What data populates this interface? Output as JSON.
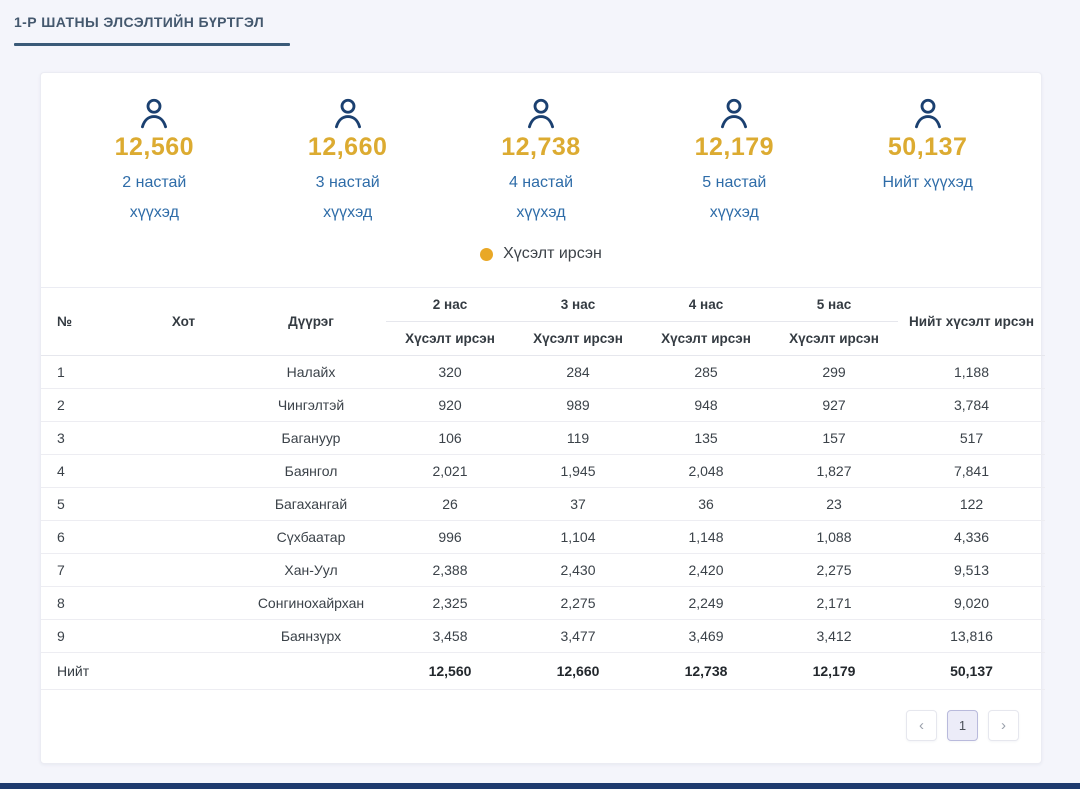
{
  "tab": {
    "title": "1-Р ШАТНЫ ЭЛСЭЛТИЙН БҮРТГЭЛ"
  },
  "stats": {
    "cards": [
      {
        "value": "12,560",
        "label1": "2 настай",
        "label2": "хүүхэд"
      },
      {
        "value": "12,660",
        "label1": "3 настай",
        "label2": "хүүхэд"
      },
      {
        "value": "12,738",
        "label1": "4 настай",
        "label2": "хүүхэд"
      },
      {
        "value": "12,179",
        "label1": "5 настай",
        "label2": "хүүхэд"
      },
      {
        "value": "50,137",
        "label1": "Нийт хүүхэд",
        "label2": ""
      }
    ],
    "legend": {
      "label": "Хүсэлт ирсэн",
      "dot_color": "#e9a826"
    }
  },
  "table": {
    "headers": {
      "no": "№",
      "city": "Хот",
      "district": "Дүүрэг",
      "age_groups": [
        "2 нас",
        "3 нас",
        "4 нас",
        "5 нас"
      ],
      "sub": "Хүсэлт ирсэн",
      "grand_total": "Нийт хүсэлт ирсэн"
    },
    "rows": [
      {
        "no": "1",
        "city": "",
        "district": "Налайх",
        "age2": "320",
        "age3": "284",
        "age4": "285",
        "age5": "299",
        "total": "1,188"
      },
      {
        "no": "2",
        "city": "",
        "district": "Чингэлтэй",
        "age2": "920",
        "age3": "989",
        "age4": "948",
        "age5": "927",
        "total": "3,784"
      },
      {
        "no": "3",
        "city": "",
        "district": "Багануур",
        "age2": "106",
        "age3": "119",
        "age4": "135",
        "age5": "157",
        "total": "517"
      },
      {
        "no": "4",
        "city": "",
        "district": "Баянгол",
        "age2": "2,021",
        "age3": "1,945",
        "age4": "2,048",
        "age5": "1,827",
        "total": "7,841"
      },
      {
        "no": "5",
        "city": "",
        "district": "Багахангай",
        "age2": "26",
        "age3": "37",
        "age4": "36",
        "age5": "23",
        "total": "122"
      },
      {
        "no": "6",
        "city": "",
        "district": "Сүхбаатар",
        "age2": "996",
        "age3": "1,104",
        "age4": "1,148",
        "age5": "1,088",
        "total": "4,336"
      },
      {
        "no": "7",
        "city": "",
        "district": "Хан-Уул",
        "age2": "2,388",
        "age3": "2,430",
        "age4": "2,420",
        "age5": "2,275",
        "total": "9,513"
      },
      {
        "no": "8",
        "city": "",
        "district": "Сонгинохайрхан",
        "age2": "2,325",
        "age3": "2,275",
        "age4": "2,249",
        "age5": "2,171",
        "total": "9,020"
      },
      {
        "no": "9",
        "city": "",
        "district": "Баянзүрх",
        "age2": "3,458",
        "age3": "3,477",
        "age4": "3,469",
        "age5": "3,412",
        "total": "13,816"
      }
    ],
    "total_row": {
      "label": "Нийт",
      "age2": "12,560",
      "age3": "12,660",
      "age4": "12,738",
      "age5": "12,179",
      "total": "50,137"
    }
  },
  "pagination": {
    "prev": "‹",
    "page": "1",
    "next": "›"
  },
  "colors": {
    "accent_gold": "#dcab31",
    "accent_blue": "#2e6ca8",
    "icon_navy": "#1b4070",
    "tab_underline": "#3a5a78",
    "page_bg": "#f4f5fb",
    "bottom_bar": "#1e3a6e"
  }
}
